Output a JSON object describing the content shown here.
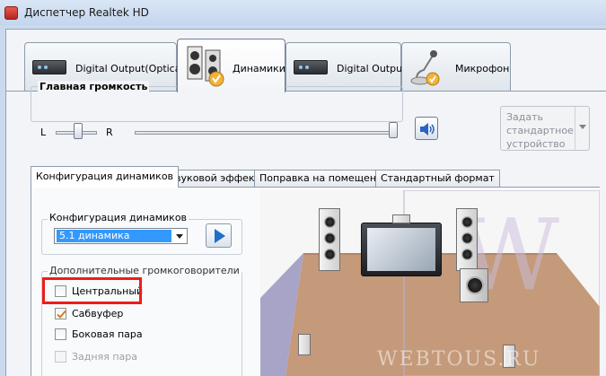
{
  "window": {
    "title": "Диспетчер Realtek HD"
  },
  "device_tabs": [
    {
      "label": "Digital Output(Optical)",
      "active": false
    },
    {
      "label": "Динамики",
      "active": true
    },
    {
      "label": "Digital Output",
      "active": false
    },
    {
      "label": "Микрофон",
      "active": false
    }
  ],
  "volume": {
    "label": "Главная громкость",
    "left": "L",
    "right": "R",
    "balance": 0.5,
    "level": 1.0
  },
  "default_device": {
    "line1": "Задать",
    "line2": "стандартное",
    "line3": "устройство"
  },
  "sub_tabs": [
    {
      "label": "Конфигурация динамиков",
      "active": true
    },
    {
      "label": "Звуковой эффект",
      "active": false
    },
    {
      "label": "Поправка на помещение",
      "active": false
    },
    {
      "label": "Стандартный формат",
      "active": false
    }
  ],
  "speaker_config": {
    "label": "Конфигурация динамиков",
    "selected": "5.1 динамика"
  },
  "extra_speakers": {
    "label": "Дополнительные громкоговорители",
    "items": [
      {
        "label": "Центральный",
        "checked": false,
        "disabled": false
      },
      {
        "label": "Сабвуфер",
        "checked": true,
        "disabled": false
      },
      {
        "label": "Боковая пара",
        "checked": false,
        "disabled": false
      },
      {
        "label": "Задняя пара",
        "checked": false,
        "disabled": true
      }
    ]
  },
  "watermark": "WEBTOUS.RU",
  "colors": {
    "highlight": "#ee1c1c",
    "floor": "#c49a7a",
    "accent": "#3399ff"
  }
}
